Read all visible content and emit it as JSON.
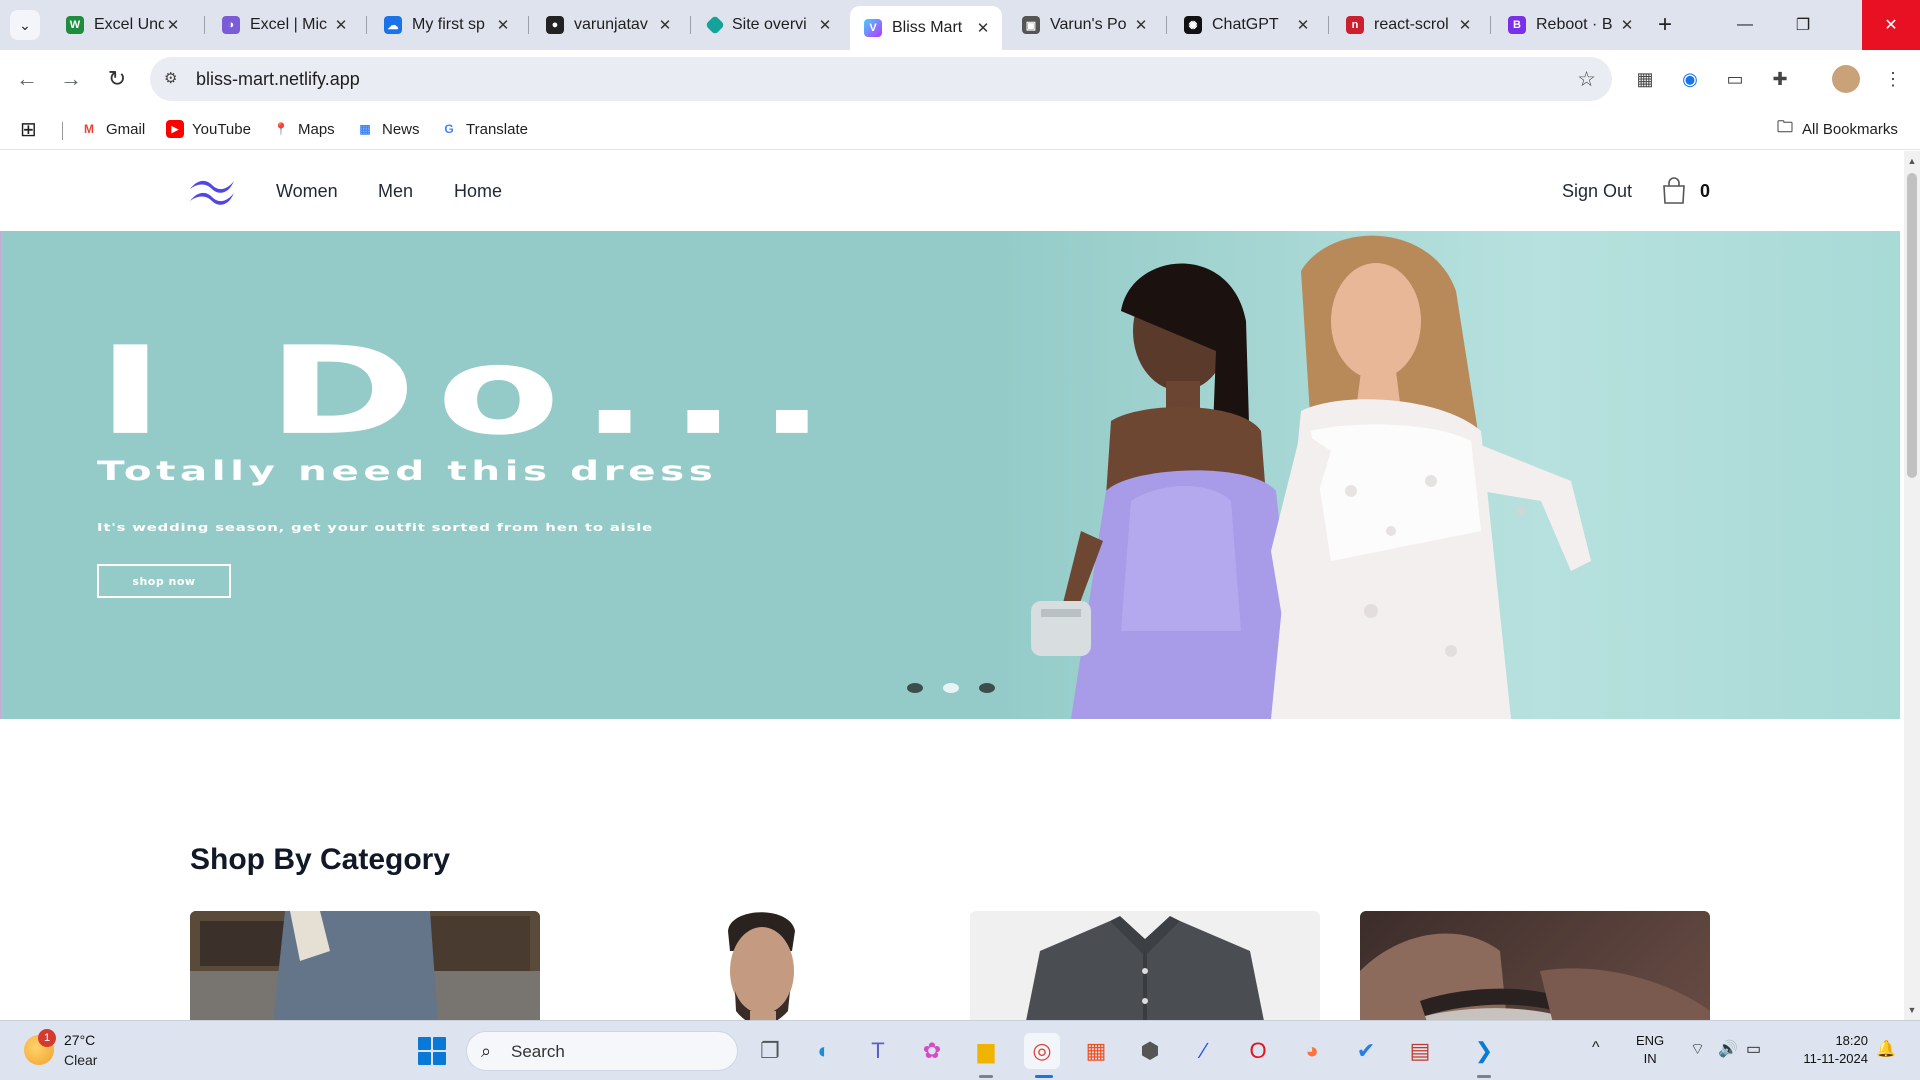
{
  "browser": {
    "tabs": [
      {
        "title": "Excel Undo",
        "favicon_color": "#1e8e3e",
        "glyph": "W"
      },
      {
        "title": "Excel | Mic",
        "favicon_color": "#7b5cd6",
        "glyph": "◑"
      },
      {
        "title": "My first sp",
        "favicon_color": "#1a73e8",
        "glyph": "☁"
      },
      {
        "title": "varunjatav",
        "favicon_color": "#222222",
        "glyph": "●"
      },
      {
        "title": "Site overvi",
        "favicon_color": "#14a39a",
        "glyph": "◆"
      },
      {
        "title": "Bliss Mart",
        "favicon_color": "#7c4dff",
        "glyph": "V",
        "active": true
      },
      {
        "title": "Varun's Po",
        "favicon_color": "#555555",
        "glyph": "▣"
      },
      {
        "title": "ChatGPT",
        "favicon_color": "#111111",
        "glyph": "✺"
      },
      {
        "title": "react-scrol",
        "favicon_color": "#cc1f2f",
        "glyph": "n"
      },
      {
        "title": "Reboot · B",
        "favicon_color": "#7a30e8",
        "glyph": "B"
      }
    ],
    "address": "bliss-mart.netlify.app",
    "bookmarks": [
      {
        "label": "Gmail",
        "color": "#ea4335",
        "glyph": "M"
      },
      {
        "label": "YouTube",
        "color": "#ff0000",
        "glyph": "▶"
      },
      {
        "label": "Maps",
        "color": "#34a853",
        "glyph": "⬤"
      },
      {
        "label": "News",
        "color": "#4285f4",
        "glyph": "▦"
      },
      {
        "label": "Translate",
        "color": "#4285f4",
        "glyph": "G"
      }
    ],
    "all_bookmarks": "All Bookmarks"
  },
  "site": {
    "nav": {
      "links": [
        "Women",
        "Men",
        "Home"
      ],
      "sign_out": "Sign Out",
      "cart_count": "0"
    },
    "hero": {
      "title": "I Do...",
      "subtitle": "Totally need this dress",
      "description": "It's wedding season, get your outfit sorted from hen to aisle",
      "button": "shop now",
      "slides": 3,
      "active_slide": 1
    },
    "section_title": "Shop By Category"
  },
  "taskbar": {
    "weather": {
      "temp": "27°C",
      "condition": "Clear",
      "badge": "1"
    },
    "search": "Search",
    "lang": {
      "top": "ENG",
      "bottom": "IN"
    },
    "clock": {
      "time": "18:20",
      "date": "11-11-2024"
    }
  },
  "colors": {
    "brand": "#4f46e5",
    "hero_bg": "#94cbc8",
    "text_dark": "#111827"
  }
}
